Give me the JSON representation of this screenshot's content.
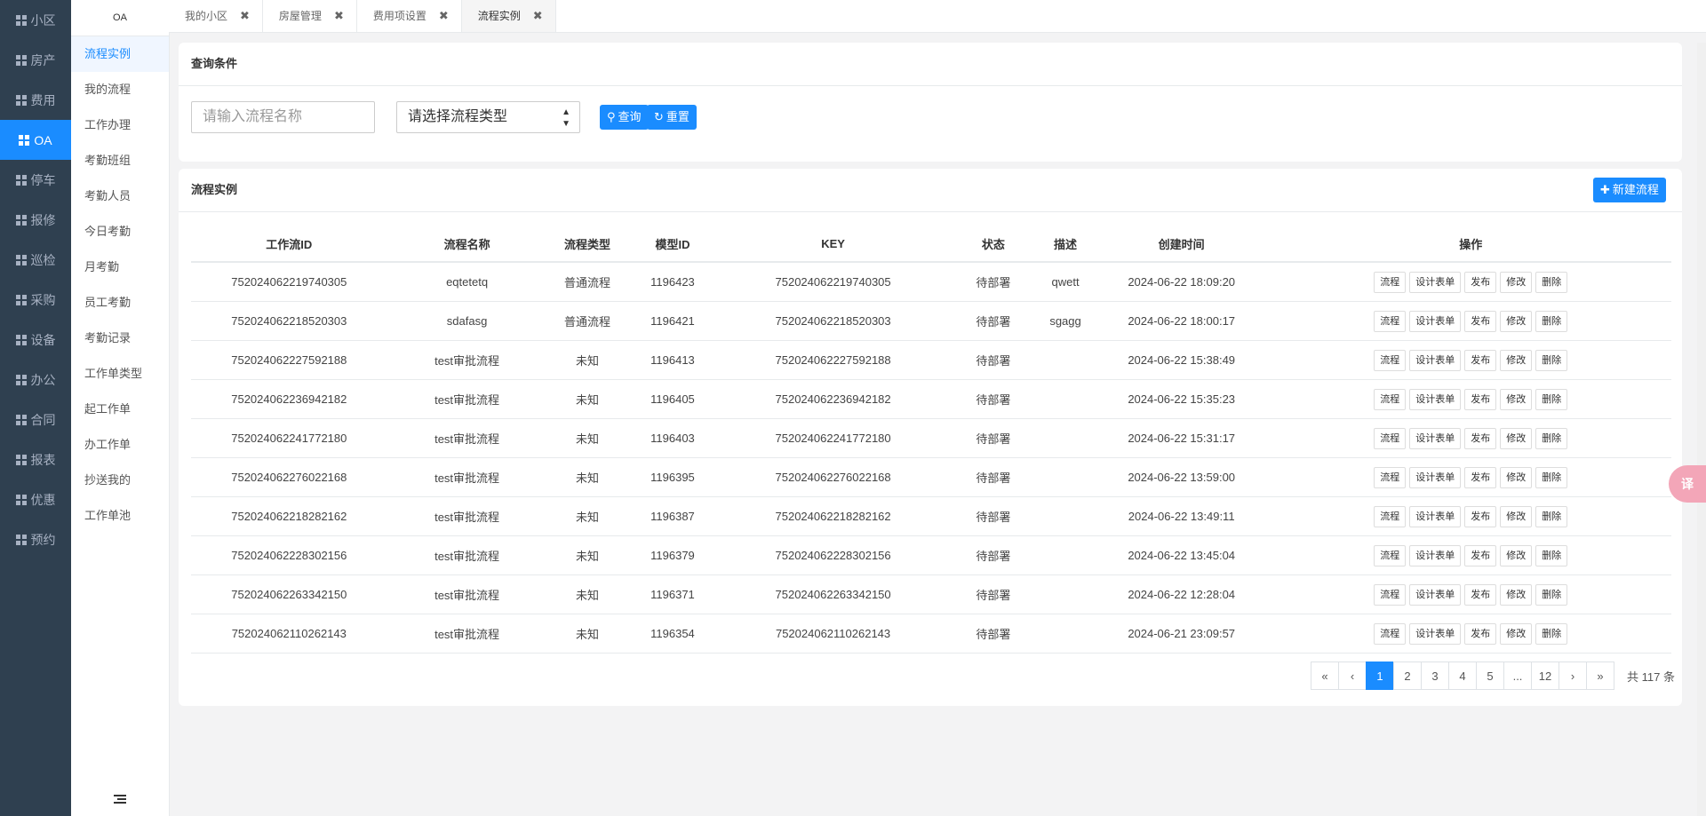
{
  "leftnav": [
    {
      "label": "小区",
      "active": false
    },
    {
      "label": "房产",
      "active": false
    },
    {
      "label": "费用",
      "active": false
    },
    {
      "label": "OA",
      "active": true
    },
    {
      "label": "停车",
      "active": false
    },
    {
      "label": "报修",
      "active": false
    },
    {
      "label": "巡检",
      "active": false
    },
    {
      "label": "采购",
      "active": false
    },
    {
      "label": "设备",
      "active": false
    },
    {
      "label": "办公",
      "active": false
    },
    {
      "label": "合同",
      "active": false
    },
    {
      "label": "报表",
      "active": false
    },
    {
      "label": "优惠",
      "active": false
    },
    {
      "label": "预约",
      "active": false
    }
  ],
  "submenu": {
    "title": "OA",
    "items": [
      "流程实例",
      "我的流程",
      "工作办理",
      "考勤班组",
      "考勤人员",
      "今日考勤",
      "月考勤",
      "员工考勤",
      "考勤记录",
      "工作单类型",
      "起工作单",
      "办工作单",
      "抄送我的",
      "工作单池"
    ]
  },
  "tabs": [
    {
      "label": "我的小区",
      "active": false
    },
    {
      "label": "房屋管理",
      "active": false
    },
    {
      "label": "费用项设置",
      "active": false
    },
    {
      "label": "流程实例",
      "active": true
    }
  ],
  "query": {
    "title": "查询条件",
    "name_placeholder": "请输入流程名称",
    "type_placeholder": "请选择流程类型",
    "search_label": "查询",
    "reset_label": "重置"
  },
  "list": {
    "title": "流程实例",
    "new_label": "新建流程",
    "columns": [
      "工作流ID",
      "流程名称",
      "流程类型",
      "模型ID",
      "KEY",
      "状态",
      "描述",
      "创建时间",
      "操作"
    ],
    "rows": [
      [
        "752024062219740305",
        "eqtetetq",
        "普通流程",
        "1196423",
        "752024062219740305",
        "待部署",
        "qwett",
        "2024-06-22 18:09:20"
      ],
      [
        "752024062218520303",
        "sdafasg",
        "普通流程",
        "1196421",
        "752024062218520303",
        "待部署",
        "sgagg",
        "2024-06-22 18:00:17"
      ],
      [
        "752024062227592188",
        "test审批流程",
        "未知",
        "1196413",
        "752024062227592188",
        "待部署",
        "",
        "2024-06-22 15:38:49"
      ],
      [
        "752024062236942182",
        "test审批流程",
        "未知",
        "1196405",
        "752024062236942182",
        "待部署",
        "",
        "2024-06-22 15:35:23"
      ],
      [
        "752024062241772180",
        "test审批流程",
        "未知",
        "1196403",
        "752024062241772180",
        "待部署",
        "",
        "2024-06-22 15:31:17"
      ],
      [
        "752024062276022168",
        "test审批流程",
        "未知",
        "1196395",
        "752024062276022168",
        "待部署",
        "",
        "2024-06-22 13:59:00"
      ],
      [
        "752024062218282162",
        "test审批流程",
        "未知",
        "1196387",
        "752024062218282162",
        "待部署",
        "",
        "2024-06-22 13:49:11"
      ],
      [
        "752024062228302156",
        "test审批流程",
        "未知",
        "1196379",
        "752024062228302156",
        "待部署",
        "",
        "2024-06-22 13:45:04"
      ],
      [
        "752024062263342150",
        "test审批流程",
        "未知",
        "1196371",
        "752024062263342150",
        "待部署",
        "",
        "2024-06-22 12:28:04"
      ],
      [
        "752024062110262143",
        "test审批流程",
        "未知",
        "1196354",
        "752024062110262143",
        "待部署",
        "",
        "2024-06-21 23:09:57"
      ]
    ],
    "actions": [
      "流程",
      "设计表单",
      "发布",
      "修改",
      "删除"
    ]
  },
  "pagination": {
    "pages": [
      "«",
      "‹",
      "1",
      "2",
      "3",
      "4",
      "5",
      "...",
      "12",
      "›",
      "»"
    ],
    "active": "1",
    "total_text": "共 117 条"
  },
  "float_button": "译",
  "colors": {
    "primary": "#1a8cff",
    "nav_bg": "#2f4050"
  }
}
